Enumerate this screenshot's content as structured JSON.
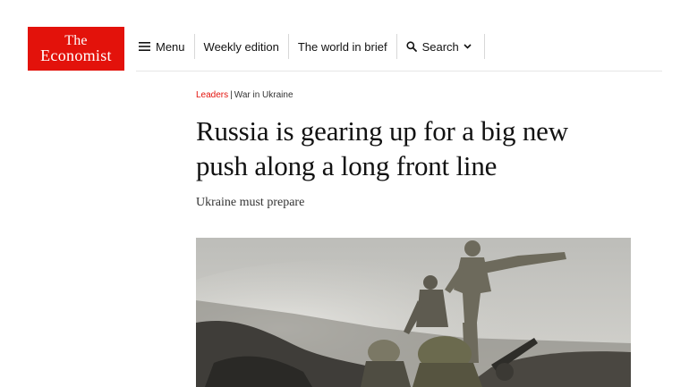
{
  "logo": {
    "line1": "The",
    "line2": "Economist"
  },
  "nav": {
    "menu_label": "Menu",
    "weekly_label": "Weekly edition",
    "world_label": "The world in brief",
    "search_label": "Search"
  },
  "article": {
    "section": "Leaders",
    "separator": "|",
    "topic": "War in Ukraine",
    "headline_line1": "Russia is gearing up for a big new",
    "headline_line2": "push along a long front line",
    "subheadline": "Ukraine must prepare"
  },
  "colors": {
    "brand_red": "#e3120b",
    "text": "#121212"
  },
  "icons": [
    "hamburger-icon",
    "search-icon",
    "chevron-down-icon"
  ]
}
